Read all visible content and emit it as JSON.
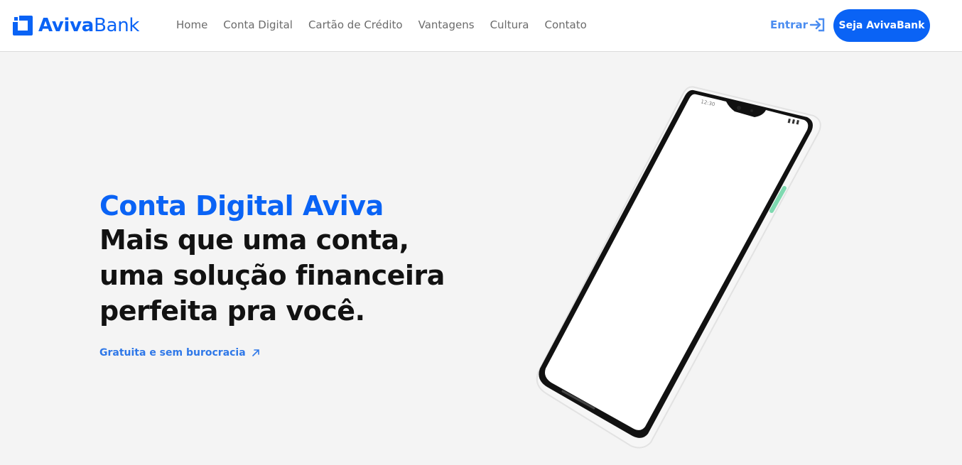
{
  "brand": {
    "name_bold": "Aviva",
    "name_light": "Bank"
  },
  "nav": {
    "items": [
      {
        "label": "Home"
      },
      {
        "label": "Conta Digital"
      },
      {
        "label": "Cartão de Crédito"
      },
      {
        "label": "Vantagens"
      },
      {
        "label": "Cultura"
      },
      {
        "label": "Contato"
      }
    ],
    "login_label": "Entrar",
    "cta_label": "Seja AvivaBank"
  },
  "hero": {
    "kicker": "Conta Digital Aviva",
    "title": "Mais que uma conta,\numa solução financeira\nperfeita pra você.",
    "link_label": "Gratuita e sem burocracia"
  },
  "phone": {
    "status_time": "12:30"
  },
  "colors": {
    "brand_blue": "#0a63f5",
    "link_blue": "#2f78e8",
    "background": "#f4f4f4",
    "text_dark": "#121212",
    "nav_gray": "#6b6b6b"
  },
  "icons": {
    "logo": "square-logo-icon",
    "login": "sign-in-icon",
    "link": "arrow-up-right-icon"
  }
}
